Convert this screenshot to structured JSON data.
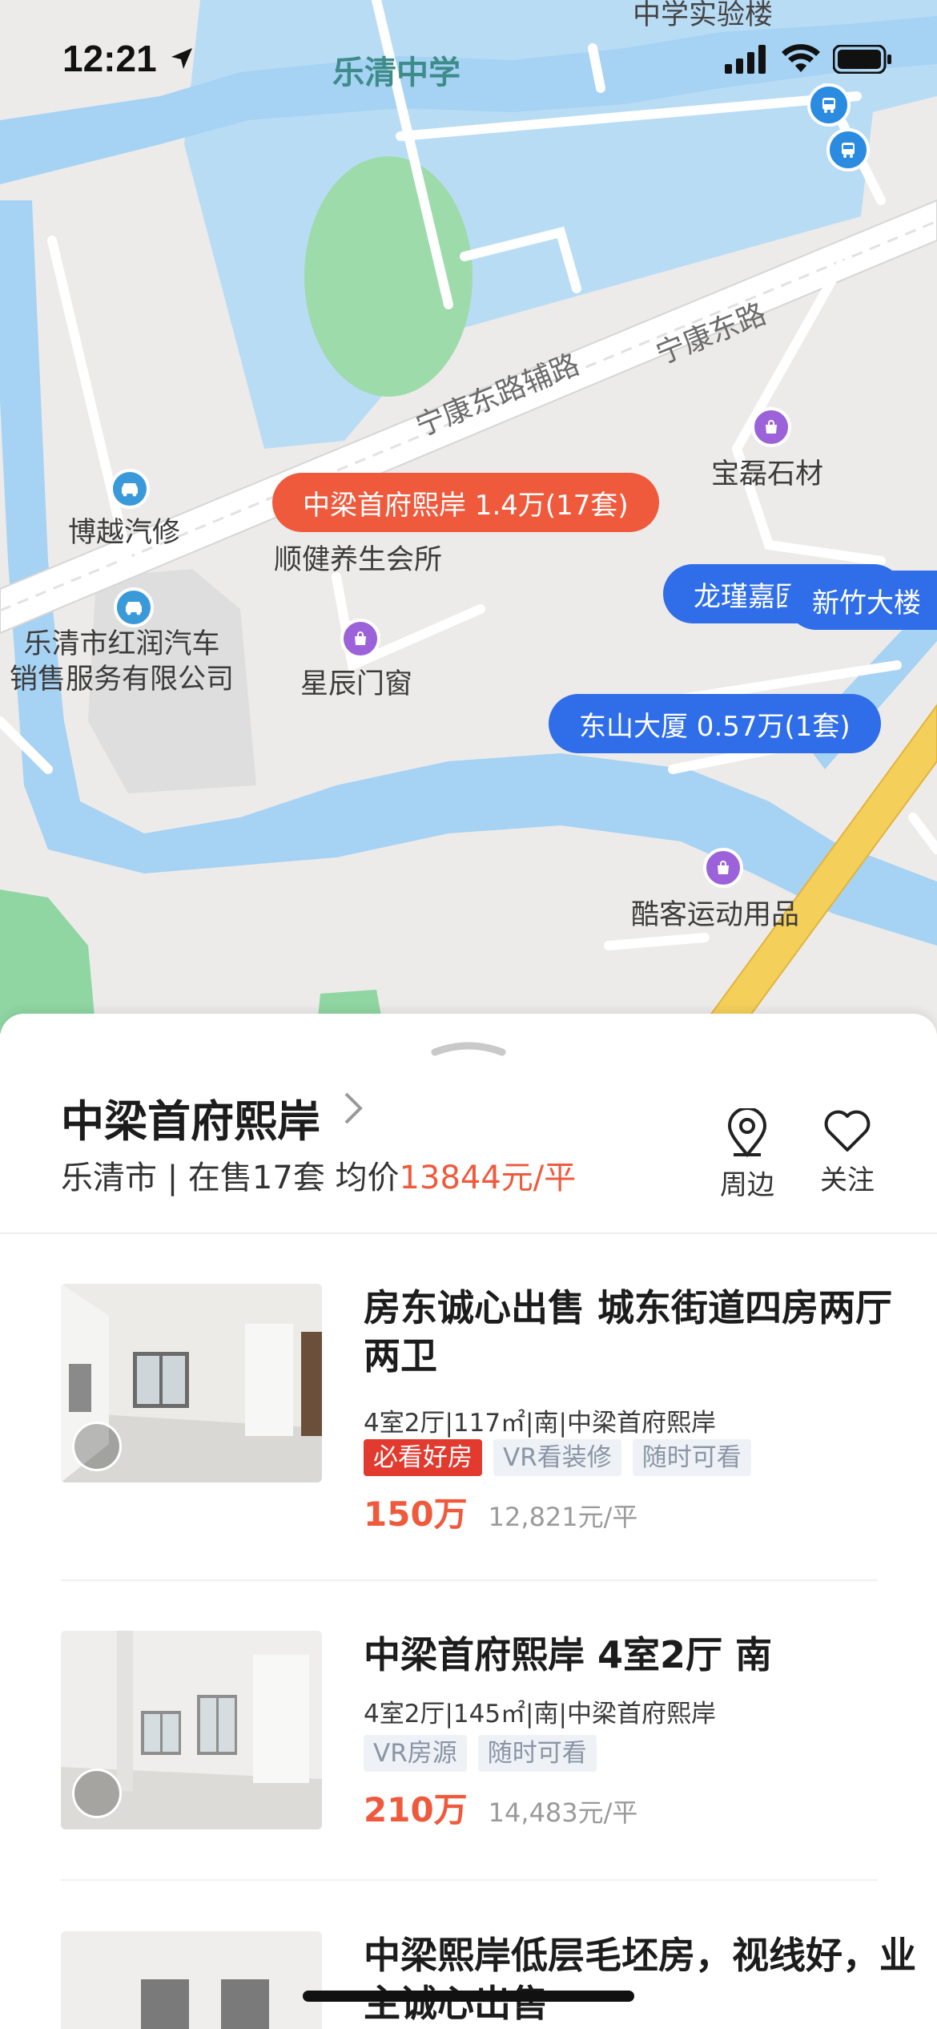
{
  "status": {
    "time": "12:21"
  },
  "map": {
    "water_labels": [
      "乐清中学"
    ],
    "road_labels": [
      "宁康东路辅路",
      "宁康东路"
    ],
    "top_clip_label": "中学实验楼",
    "pois": [
      {
        "name": "博越汽修",
        "icon": "car-icon"
      },
      {
        "name": "顺健养生会所",
        "icon": "none"
      },
      {
        "name": "乐清市红润汽车\n销售服务有限公司",
        "icon": "car-icon"
      },
      {
        "name": "星辰门窗",
        "icon": "shop-icon"
      },
      {
        "name": "宝磊石材",
        "icon": "shop-icon"
      },
      {
        "name": "酷客运动用品",
        "icon": "shop-icon"
      }
    ],
    "pins": [
      {
        "label": "中梁首府熙岸 1.4万(17套)",
        "color": "#ef5a3d"
      },
      {
        "label": "龙瑾嘉园",
        "color": "#2f6ee8"
      },
      {
        "label": "新竹大楼",
        "color": "#2f6ee8"
      },
      {
        "label": "东山大厦 0.57万(1套)",
        "color": "#2f6ee8"
      }
    ]
  },
  "project": {
    "name": "中梁首府熙岸",
    "city": "乐清市",
    "on_sale": "在售17套",
    "avg_label": "均价",
    "avg_price": "13844元/平",
    "separator": "|",
    "actions": [
      {
        "label": "周边",
        "icon": "location-pin-icon"
      },
      {
        "label": "关注",
        "icon": "heart-icon"
      }
    ]
  },
  "listings": [
    {
      "title": "房东诚心出售 城东街道四房两厅两卫",
      "spec": "4室2厅|117㎡|南|中梁首府熙岸",
      "tags": [
        {
          "text": "必看好房",
          "style": "red"
        },
        {
          "text": "VR看装修",
          "style": "grey"
        },
        {
          "text": "随时可看",
          "style": "grey"
        }
      ],
      "price": "150万",
      "unit_price": "12,821元/平"
    },
    {
      "title": "中梁首府熙岸 4室2厅 南",
      "spec": "4室2厅|145㎡|南|中梁首府熙岸",
      "tags": [
        {
          "text": "VR房源",
          "style": "grey"
        },
        {
          "text": "随时可看",
          "style": "grey"
        }
      ],
      "price": "210万",
      "unit_price": "14,483元/平"
    },
    {
      "title": "中梁熙岸低层毛坯房，视线好，业主诚心出售"
    }
  ],
  "colors": {
    "accent": "#ef5a3d",
    "pin_blue": "#2f6ee8",
    "water": "#a7d3f2",
    "green": "#8fd6a2"
  }
}
